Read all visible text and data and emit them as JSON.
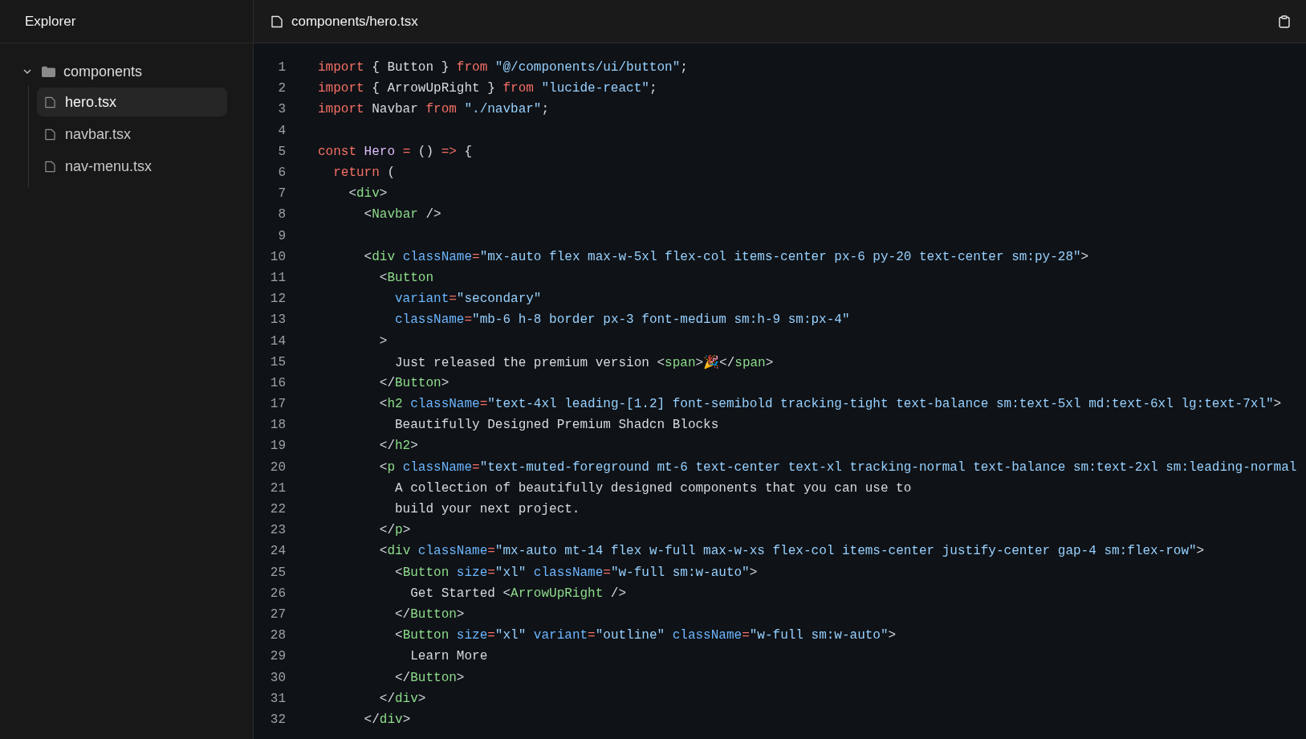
{
  "sidebar": {
    "title": "Explorer",
    "tree": [
      {
        "label": "components",
        "kind": "folder",
        "expanded": true,
        "children": [
          {
            "label": "hero.tsx",
            "kind": "file",
            "selected": true
          },
          {
            "label": "navbar.tsx",
            "kind": "file",
            "selected": false
          },
          {
            "label": "nav-menu.tsx",
            "kind": "file",
            "selected": false
          }
        ]
      }
    ]
  },
  "editor": {
    "file_path": "components/hero.tsx",
    "lines": [
      {
        "number": "1",
        "tokens": [
          {
            "kind": "keyword",
            "text": "import"
          },
          {
            "kind": "plain",
            "text": " { Button } "
          },
          {
            "kind": "keyword",
            "text": "from"
          },
          {
            "kind": "string",
            "text": " \"@/components/ui/button\""
          },
          {
            "kind": "plain",
            "text": ";"
          }
        ]
      },
      {
        "number": "2",
        "tokens": [
          {
            "kind": "keyword",
            "text": "import"
          },
          {
            "kind": "plain",
            "text": " { ArrowUpRight } "
          },
          {
            "kind": "keyword",
            "text": "from"
          },
          {
            "kind": "string",
            "text": " \"lucide-react\""
          },
          {
            "kind": "plain",
            "text": ";"
          }
        ]
      },
      {
        "number": "3",
        "tokens": [
          {
            "kind": "keyword",
            "text": "import"
          },
          {
            "kind": "plain",
            "text": " Navbar "
          },
          {
            "kind": "keyword",
            "text": "from"
          },
          {
            "kind": "string",
            "text": " \"./navbar\""
          },
          {
            "kind": "plain",
            "text": ";"
          }
        ]
      },
      {
        "number": "4"
      },
      {
        "number": "5",
        "tokens": [
          {
            "kind": "keyword",
            "text": "const"
          },
          {
            "kind": "function",
            "text": " Hero"
          },
          {
            "kind": "keyword",
            "text": " ="
          },
          {
            "kind": "plain",
            "text": " () "
          },
          {
            "kind": "keyword",
            "text": "=>"
          },
          {
            "kind": "plain",
            "text": " {"
          }
        ]
      },
      {
        "number": "6",
        "tokens": [
          {
            "kind": "keyword",
            "text": "  return"
          },
          {
            "kind": "plain",
            "text": " ("
          }
        ]
      },
      {
        "number": "7",
        "tokens": [
          {
            "kind": "plain",
            "text": "    <"
          },
          {
            "kind": "tag",
            "text": "div"
          },
          {
            "kind": "plain",
            "text": ">"
          }
        ]
      },
      {
        "number": "8",
        "tokens": [
          {
            "kind": "plain",
            "text": "      <"
          },
          {
            "kind": "tag",
            "text": "Navbar"
          },
          {
            "kind": "plain",
            "text": " />"
          }
        ]
      },
      {
        "number": "9"
      },
      {
        "number": "10",
        "tokens": [
          {
            "kind": "plain",
            "text": "      <"
          },
          {
            "kind": "tag",
            "text": "div"
          },
          {
            "kind": "attribute",
            "text": " className"
          },
          {
            "kind": "keyword",
            "text": "="
          },
          {
            "kind": "string",
            "text": "\"mx-auto flex max-w-5xl flex-col items-center px-6 py-20 text-center sm:py-28\""
          },
          {
            "kind": "plain",
            "text": ">"
          }
        ]
      },
      {
        "number": "11",
        "tokens": [
          {
            "kind": "plain",
            "text": "        <"
          },
          {
            "kind": "tag",
            "text": "Button"
          }
        ]
      },
      {
        "number": "12",
        "tokens": [
          {
            "kind": "attribute",
            "text": "          variant"
          },
          {
            "kind": "keyword",
            "text": "="
          },
          {
            "kind": "string",
            "text": "\"secondary\""
          }
        ]
      },
      {
        "number": "13",
        "tokens": [
          {
            "kind": "attribute",
            "text": "          className"
          },
          {
            "kind": "keyword",
            "text": "="
          },
          {
            "kind": "string",
            "text": "\"mb-6 h-8 border px-3 font-medium sm:h-9 sm:px-4\""
          }
        ]
      },
      {
        "number": "14",
        "tokens": [
          {
            "kind": "plain",
            "text": "        >"
          }
        ]
      },
      {
        "number": "15",
        "tokens": [
          {
            "kind": "plain",
            "text": "          Just released the premium version <"
          },
          {
            "kind": "tag",
            "text": "span"
          },
          {
            "kind": "plain",
            "text": ">🎉</"
          },
          {
            "kind": "tag",
            "text": "span"
          },
          {
            "kind": "plain",
            "text": ">"
          }
        ]
      },
      {
        "number": "16",
        "tokens": [
          {
            "kind": "plain",
            "text": "        </"
          },
          {
            "kind": "tag",
            "text": "Button"
          },
          {
            "kind": "plain",
            "text": ">"
          }
        ]
      },
      {
        "number": "17",
        "tokens": [
          {
            "kind": "plain",
            "text": "        <"
          },
          {
            "kind": "tag",
            "text": "h2"
          },
          {
            "kind": "attribute",
            "text": " className"
          },
          {
            "kind": "keyword",
            "text": "="
          },
          {
            "kind": "string",
            "text": "\"text-4xl leading-[1.2] font-semibold tracking-tight text-balance sm:text-5xl md:text-6xl lg:text-7xl\""
          },
          {
            "kind": "plain",
            "text": ">"
          }
        ]
      },
      {
        "number": "18",
        "tokens": [
          {
            "kind": "plain",
            "text": "          Beautifully Designed Premium Shadcn Blocks"
          }
        ]
      },
      {
        "number": "19",
        "tokens": [
          {
            "kind": "plain",
            "text": "        </"
          },
          {
            "kind": "tag",
            "text": "h2"
          },
          {
            "kind": "plain",
            "text": ">"
          }
        ]
      },
      {
        "number": "20",
        "tokens": [
          {
            "kind": "plain",
            "text": "        <"
          },
          {
            "kind": "tag",
            "text": "p"
          },
          {
            "kind": "attribute",
            "text": " className"
          },
          {
            "kind": "keyword",
            "text": "="
          },
          {
            "kind": "string",
            "text": "\"text-muted-foreground mt-6 text-center text-xl tracking-normal text-balance sm:text-2xl sm:leading-normal"
          }
        ]
      },
      {
        "number": "21",
        "tokens": [
          {
            "kind": "plain",
            "text": "          A collection of beautifully designed components that you can use to"
          }
        ]
      },
      {
        "number": "22",
        "tokens": [
          {
            "kind": "plain",
            "text": "          build your next project."
          }
        ]
      },
      {
        "number": "23",
        "tokens": [
          {
            "kind": "plain",
            "text": "        </"
          },
          {
            "kind": "tag",
            "text": "p"
          },
          {
            "kind": "plain",
            "text": ">"
          }
        ]
      },
      {
        "number": "24",
        "tokens": [
          {
            "kind": "plain",
            "text": "        <"
          },
          {
            "kind": "tag",
            "text": "div"
          },
          {
            "kind": "attribute",
            "text": " className"
          },
          {
            "kind": "keyword",
            "text": "="
          },
          {
            "kind": "string",
            "text": "\"mx-auto mt-14 flex w-full max-w-xs flex-col items-center justify-center gap-4 sm:flex-row\""
          },
          {
            "kind": "plain",
            "text": ">"
          }
        ]
      },
      {
        "number": "25",
        "tokens": [
          {
            "kind": "plain",
            "text": "          <"
          },
          {
            "kind": "tag",
            "text": "Button"
          },
          {
            "kind": "attribute",
            "text": " size"
          },
          {
            "kind": "keyword",
            "text": "="
          },
          {
            "kind": "string",
            "text": "\"xl\""
          },
          {
            "kind": "attribute",
            "text": " className"
          },
          {
            "kind": "keyword",
            "text": "="
          },
          {
            "kind": "string",
            "text": "\"w-full sm:w-auto\""
          },
          {
            "kind": "plain",
            "text": ">"
          }
        ]
      },
      {
        "number": "26",
        "tokens": [
          {
            "kind": "plain",
            "text": "            Get Started <"
          },
          {
            "kind": "tag",
            "text": "ArrowUpRight"
          },
          {
            "kind": "plain",
            "text": " />"
          }
        ]
      },
      {
        "number": "27",
        "tokens": [
          {
            "kind": "plain",
            "text": "          </"
          },
          {
            "kind": "tag",
            "text": "Button"
          },
          {
            "kind": "plain",
            "text": ">"
          }
        ]
      },
      {
        "number": "28",
        "tokens": [
          {
            "kind": "plain",
            "text": "          <"
          },
          {
            "kind": "tag",
            "text": "Button"
          },
          {
            "kind": "attribute",
            "text": " size"
          },
          {
            "kind": "keyword",
            "text": "="
          },
          {
            "kind": "string",
            "text": "\"xl\""
          },
          {
            "kind": "attribute",
            "text": " variant"
          },
          {
            "kind": "keyword",
            "text": "="
          },
          {
            "kind": "string",
            "text": "\"outline\""
          },
          {
            "kind": "attribute",
            "text": " className"
          },
          {
            "kind": "keyword",
            "text": "="
          },
          {
            "kind": "string",
            "text": "\"w-full sm:w-auto\""
          },
          {
            "kind": "plain",
            "text": ">"
          }
        ]
      },
      {
        "number": "29",
        "tokens": [
          {
            "kind": "plain",
            "text": "            Learn More"
          }
        ]
      },
      {
        "number": "30",
        "tokens": [
          {
            "kind": "plain",
            "text": "          </"
          },
          {
            "kind": "tag",
            "text": "Button"
          },
          {
            "kind": "plain",
            "text": ">"
          }
        ]
      },
      {
        "number": "31",
        "tokens": [
          {
            "kind": "plain",
            "text": "        </"
          },
          {
            "kind": "tag",
            "text": "div"
          },
          {
            "kind": "plain",
            "text": ">"
          }
        ]
      },
      {
        "number": "32",
        "tokens": [
          {
            "kind": "plain",
            "text": "      </"
          },
          {
            "kind": "tag",
            "text": "div"
          },
          {
            "kind": "plain",
            "text": ">"
          }
        ]
      }
    ]
  }
}
